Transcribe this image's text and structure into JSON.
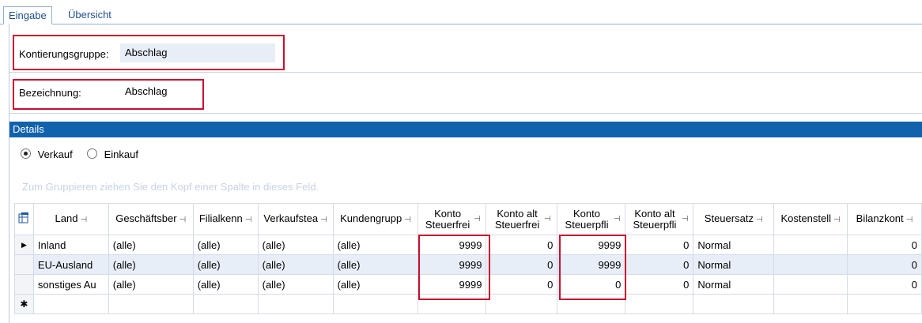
{
  "tabs": [
    {
      "label": "Eingabe",
      "active": true
    },
    {
      "label": "Übersicht",
      "active": false
    }
  ],
  "form": {
    "kontierungsgruppe_label": "Kontierungsgruppe:",
    "kontierungsgruppe_value": "Abschlag",
    "bezeichnung_label": "Bezeichnung:",
    "bezeichnung_value": "Abschlag"
  },
  "details": {
    "title": "Details",
    "radio_verkauf": "Verkauf",
    "radio_einkauf": "Einkauf",
    "selected": "Verkauf",
    "group_hint": "Zum Gruppieren ziehen Sie den Kopf einer Spalte in dieses Feld."
  },
  "grid": {
    "columns": [
      "Land",
      "Geschäftsber",
      "Filialkenn",
      "Verkaufstea",
      "Kundengrupp",
      "Konto Steuerfrei",
      "Konto alt Steuerfrei",
      "Konto Steuerpfli",
      "Konto alt Steuerpfli",
      "Steuersatz",
      "Kostenstell",
      "Bilanzkont"
    ],
    "rows": [
      [
        "Inland",
        "(alle)",
        "(alle)",
        "(alle)",
        "(alle)",
        "9999",
        "0",
        "9999",
        "0",
        "Normal",
        "",
        "0"
      ],
      [
        "EU-Ausland",
        "(alle)",
        "(alle)",
        "(alle)",
        "(alle)",
        "9999",
        "0",
        "9999",
        "0",
        "Normal",
        "",
        "0"
      ],
      [
        "sonstiges Au",
        "(alle)",
        "(alle)",
        "(alle)",
        "(alle)",
        "9999",
        "0",
        "0",
        "0",
        "Normal",
        "",
        "0"
      ]
    ],
    "current_row_marker": "▶",
    "new_row_marker": "✱"
  },
  "colors": {
    "header_blue": "#1162ad",
    "highlight_red": "#c8102e"
  }
}
